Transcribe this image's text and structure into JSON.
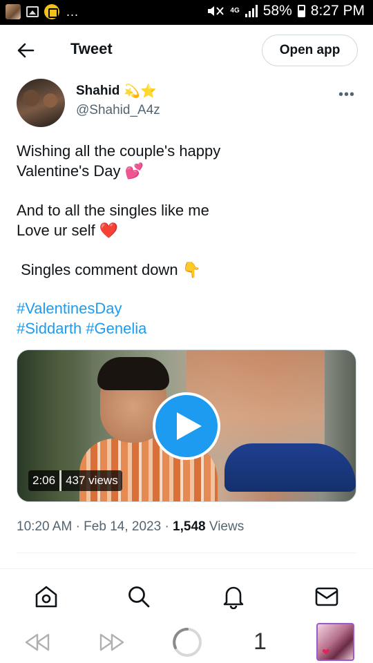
{
  "status_bar": {
    "network_type": "4G",
    "battery": "58%",
    "time": "8:27 PM",
    "overflow": "..."
  },
  "header": {
    "title": "Tweet",
    "open_app_label": "Open app"
  },
  "author": {
    "name": "Shahid",
    "name_emoji": "💫⭐",
    "handle": "@Shahid_A4z"
  },
  "tweet": {
    "line1": "Wishing all the couple's happy",
    "line2": "Valentine's Day 💕",
    "line3": "And to all the singles like me",
    "line4": "Love ur self ❤️",
    "line5": " Singles comment down 👇",
    "hashtag1": "#ValentinesDay",
    "hashtag2": "#Siddarth",
    "hashtag3": "#Genelia"
  },
  "video": {
    "duration": "2:06",
    "views": "437 views"
  },
  "meta": {
    "time": "10:20 AM",
    "dot1": "·",
    "date": "Feb 14, 2023",
    "dot2": "·",
    "view_count": "1,548",
    "views_label": "Views"
  },
  "bottom_nav": {
    "items": [
      "home-icon",
      "search-icon",
      "notifications-icon",
      "messages-icon"
    ]
  },
  "browser_bar": {
    "tab_count": "1"
  },
  "colors": {
    "accent": "#1d9bf0",
    "text": "#0f1419",
    "muted": "#536471"
  }
}
